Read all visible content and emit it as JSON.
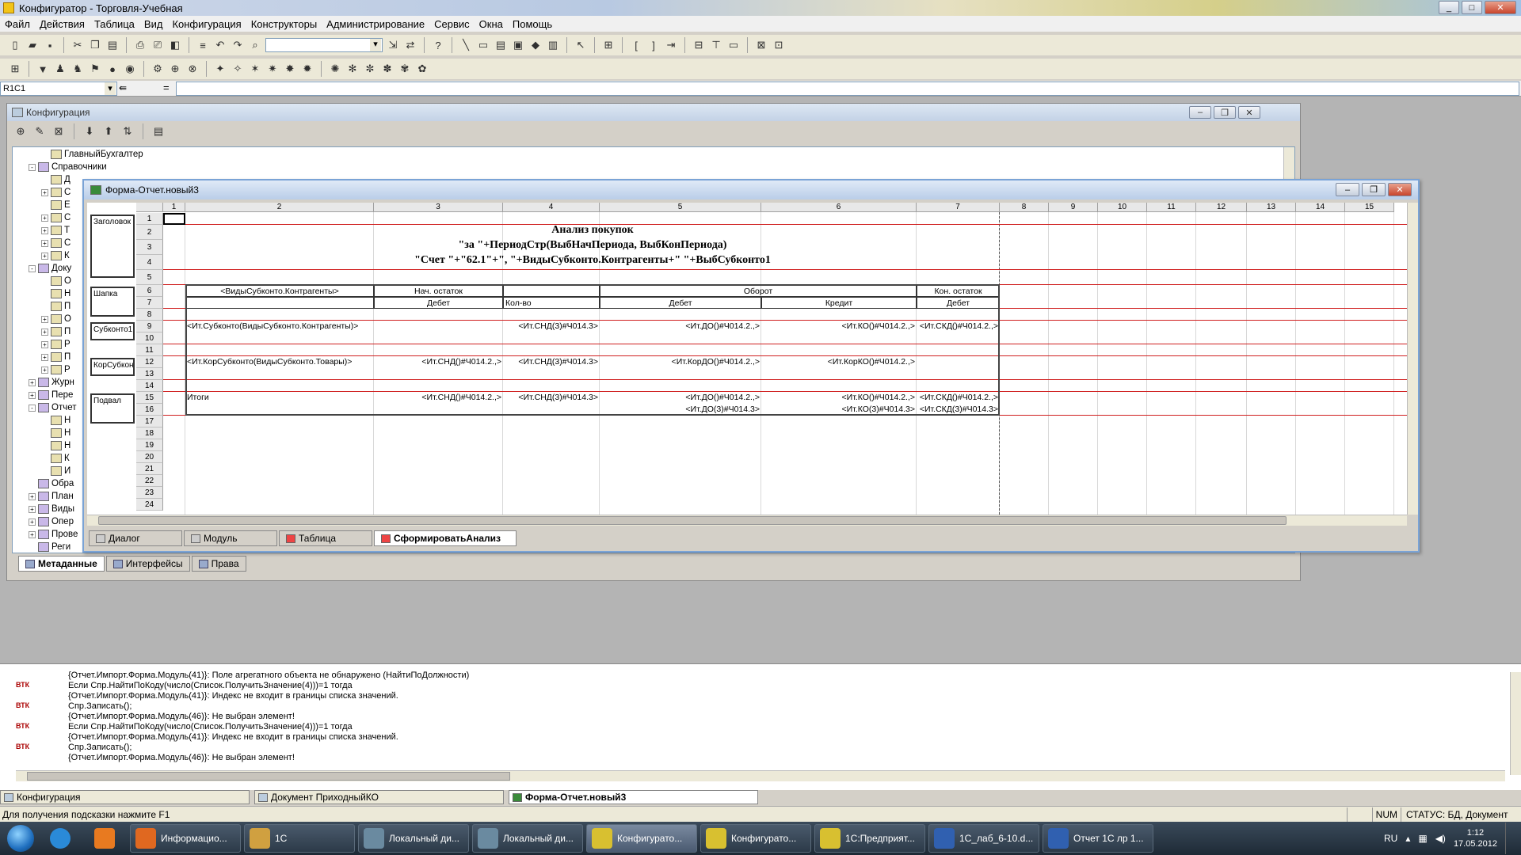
{
  "window": {
    "title": "Конфигуратор - Торговля-Учебная"
  },
  "menu": [
    "Файл",
    "Действия",
    "Таблица",
    "Вид",
    "Конфигурация",
    "Конструкторы",
    "Администрирование",
    "Сервис",
    "Окна",
    "Помощь"
  ],
  "formula": {
    "cell_ref": "R1C1",
    "eq": "="
  },
  "config_panel": {
    "title": "Конфигурация",
    "tree": [
      {
        "label": "ГлавныйБухгалтер",
        "indent": 3
      },
      {
        "label": "Справочники",
        "indent": 2,
        "exp": "-"
      },
      {
        "label": "Д",
        "indent": 3
      },
      {
        "label": "С",
        "indent": 3,
        "exp": "+"
      },
      {
        "label": "Е",
        "indent": 3
      },
      {
        "label": "С",
        "indent": 3,
        "exp": "+"
      },
      {
        "label": "Т",
        "indent": 3,
        "exp": "+"
      },
      {
        "label": "С",
        "indent": 3,
        "exp": "+"
      },
      {
        "label": "К",
        "indent": 3,
        "exp": "+"
      },
      {
        "label": "Доку",
        "indent": 2,
        "exp": "-"
      },
      {
        "label": "О",
        "indent": 3
      },
      {
        "label": "Н",
        "indent": 3
      },
      {
        "label": "П",
        "indent": 3
      },
      {
        "label": "О",
        "indent": 3,
        "exp": "+"
      },
      {
        "label": "П",
        "indent": 3,
        "exp": "+"
      },
      {
        "label": "Р",
        "indent": 3,
        "exp": "+"
      },
      {
        "label": "П",
        "indent": 3,
        "exp": "+"
      },
      {
        "label": "Р",
        "indent": 3,
        "exp": "+"
      },
      {
        "label": "Журн",
        "indent": 2,
        "exp": "+"
      },
      {
        "label": "Пере",
        "indent": 2,
        "exp": "+"
      },
      {
        "label": "Отчет",
        "indent": 2,
        "exp": "-"
      },
      {
        "label": "Н",
        "indent": 3
      },
      {
        "label": "Н",
        "indent": 3
      },
      {
        "label": "Н",
        "indent": 3
      },
      {
        "label": "К",
        "indent": 3
      },
      {
        "label": "И",
        "indent": 3
      },
      {
        "label": "Обра",
        "indent": 2
      },
      {
        "label": "План",
        "indent": 2,
        "exp": "+"
      },
      {
        "label": "Виды",
        "indent": 2,
        "exp": "+"
      },
      {
        "label": "Опер",
        "indent": 2,
        "exp": "+"
      },
      {
        "label": "Прове",
        "indent": 2,
        "exp": "+"
      },
      {
        "label": "Реги",
        "indent": 2
      }
    ],
    "tabs": [
      "Метаданные",
      "Интерфейсы",
      "Права"
    ]
  },
  "form": {
    "title": "Форма-Отчет.новый3",
    "col_headers": [
      "1",
      "2",
      "3",
      "4",
      "5",
      "6",
      "7",
      "8",
      "9",
      "10",
      "11",
      "12",
      "13",
      "14",
      "15"
    ],
    "row_headers": [
      "1",
      "2",
      "3",
      "4",
      "5",
      "6",
      "7",
      "8",
      "9",
      "10",
      "11",
      "12",
      "13",
      "14",
      "15",
      "16",
      "17",
      "18",
      "19",
      "20",
      "21",
      "22",
      "23",
      "24"
    ],
    "sections": [
      "Заголовок",
      "Шапка",
      "Субконто1",
      "КорСубкон",
      "Подвал"
    ],
    "report": {
      "title1": "Анализ покупок",
      "title2": "\"за \"+ПериодСтр(ВыбНачПериода, ВыбКонПериода)",
      "title3": "\"Счет \"+\"62.1\"+\", \"+ВидыСубконто.Контрагенты+\" \"+ВыбСубконто1",
      "h_vid": "<ВидыСубконто.Контрагенты>",
      "h_nach": "Нач. остаток",
      "h_oborot": "Оборот",
      "h_kon": "Кон. остаток",
      "h_debet1": "Дебет",
      "h_kolvo": "Кол-во",
      "h_debet2": "Дебет",
      "h_kredit": "Кредит",
      "h_debet3": "Дебет",
      "r9_c2": "<Ит.Субконто(ВидыСубконто.Контрагенты)>",
      "r9_c4": "<Ит.СНД(3)#Ч014.3>",
      "r9_c5": "<Ит.ДО()#Ч014.2.,>",
      "r9_c6": "<Ит.КО()#Ч014.2.,>",
      "r9_c7": "<Ит.СКД()#Ч014.2.,>",
      "r12_c2": "<Ит.КорСубконто(ВидыСубконто.Товары)>",
      "r12_c3": "<Ит.СНД()#Ч014.2.,>",
      "r12_c4": "<Ит.СНД(3)#Ч014.3>",
      "r12_c5": "<Ит.КорДО()#Ч014.2.,>",
      "r12_c6": "<Ит.КорКО()#Ч014.2.,>",
      "r15_c2": "Итоги",
      "r15_c3": "<Ит.СНД()#Ч014.2.,>",
      "r15_c4": "<Ит.СНД(3)#Ч014.3>",
      "r15_c5": "<Ит.ДО()#Ч014.2.,>",
      "r15_c6": "<Ит.КО()#Ч014.2.,>",
      "r15_c7": "<Ит.СКД()#Ч014.2.,>",
      "r16_c5": "<Ит.ДО(3)#Ч014.3>",
      "r16_c6": "<Ит.КО(3)#Ч014.3>",
      "r16_c7": "<Ит.СКД(3)#Ч014.3>"
    },
    "tabs": [
      "Диалог",
      "Модуль",
      "Таблица",
      "СформироватьАнализ"
    ]
  },
  "log": [
    "{Отчет.Импорт.Форма.Модуль(41)}: Поле агрегатного объекта не обнаружено (НайтиПоДолжности)",
    "Если Спр.НайтиПоКоду(число(Список.ПолучитьЗначение(4)))=1 тогда",
    "{Отчет.Импорт.Форма.Модуль(41)}: Индекс не входит в границы списка значений.",
    "Спр.Записать();",
    "{Отчет.Импорт.Форма.Модуль(46)}: Не выбран элемент!",
    "Если Спр.НайтиПоКоду(число(Список.ПолучитьЗначение(4)))=1 тогда",
    "{Отчет.Импорт.Форма.Модуль(41)}: Индекс не входит в границы списка значений.",
    "Спр.Записать();",
    "{Отчет.Импорт.Форма.Модуль(46)}: Не выбран элемент!"
  ],
  "log_mark": "ВТК",
  "window_tabs": [
    "Конфигурация",
    "Документ ПриходныйКО",
    "Форма-Отчет.новый3"
  ],
  "status": {
    "hint": "Для получения подсказки нажмите F1",
    "num": "NUM",
    "state": "СТАТУС: БД, Документ"
  },
  "taskbar": {
    "tasks": [
      "Информацио...",
      "1С",
      "Локальный ди...",
      "Локальный ди...",
      "Конфигурато...",
      "Конфигурато...",
      "1С:Предприят...",
      "1С_лаб_6-10.d...",
      "Отчет 1С лр 1..."
    ],
    "lang": "RU",
    "time": "1:12",
    "date": "17.05.2012"
  }
}
